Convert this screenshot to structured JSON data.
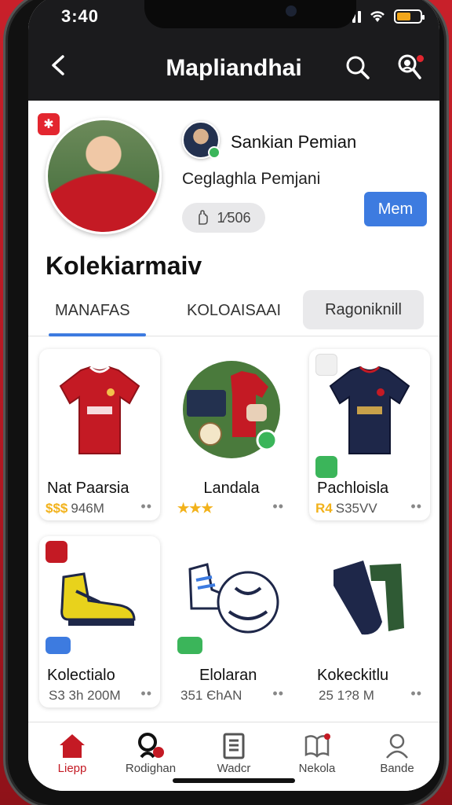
{
  "status_bar": {
    "time": "3:40"
  },
  "header": {
    "title": "Mapliandhai"
  },
  "profile": {
    "player_name": "Sankian Pemian",
    "subtitle": "Ceglaghla Pemjani",
    "stat": "1⁄506",
    "follow_label": "Mem"
  },
  "section_title": "Kolekiarmaiv",
  "tabs": [
    {
      "label": "MANAFAS"
    },
    {
      "label": "KOLOAISAAI"
    },
    {
      "label": "Ragoniknill"
    }
  ],
  "cards": [
    {
      "name": "Nat Paarsia",
      "stars": "$$$",
      "meta": "946M",
      "icon": "red-jersey"
    },
    {
      "name": "Landala",
      "stars": "★★★",
      "meta": "",
      "icon": "football-kit-collage"
    },
    {
      "name": "Pachloisla",
      "stars": "R4",
      "meta": "S35VV",
      "icon": "navy-jersey"
    },
    {
      "name": "Kolectialo",
      "stars": "",
      "meta": "S3 3h 200M",
      "icon": "yellow-boots"
    },
    {
      "name": "Elolaran",
      "stars": "",
      "meta": "351 ЄhAN",
      "icon": "boots-and-ball"
    },
    {
      "name": "Kokeckitlu",
      "stars": "",
      "meta": "25 1?8 M",
      "icon": "socks"
    }
  ],
  "nav": [
    {
      "label": "Liepp",
      "icon": "home-icon"
    },
    {
      "label": "Rodighan",
      "icon": "search-person-icon"
    },
    {
      "label": "Wadcr",
      "icon": "document-icon"
    },
    {
      "label": "Nekola",
      "icon": "book-icon"
    },
    {
      "label": "Bande",
      "icon": "user-icon"
    }
  ],
  "colors": {
    "accent": "#c41a24",
    "primary": "#3d7be0",
    "header_bg": "#1b1b1d"
  }
}
